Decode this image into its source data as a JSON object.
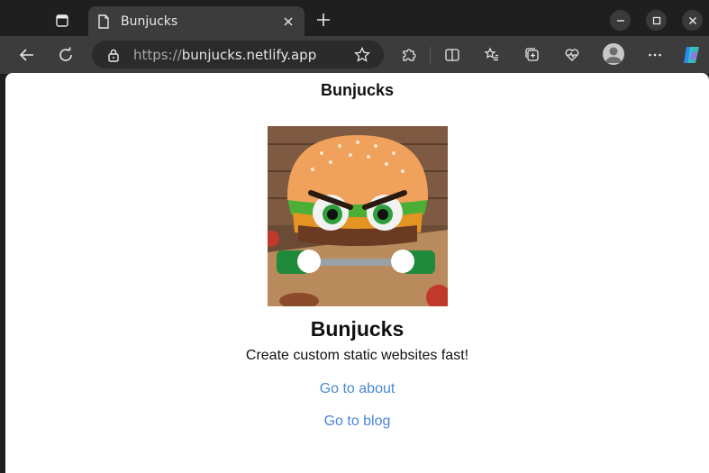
{
  "browser": {
    "tab": {
      "title": "Bunjucks"
    },
    "address": {
      "scheme": "https://",
      "host": "bunjucks.netlify.app"
    },
    "icons": [
      "tab-actions-icon",
      "page-icon",
      "close-icon",
      "plus-icon",
      "minimize-icon",
      "maximize-icon",
      "close-window-icon",
      "back-icon",
      "refresh-icon",
      "lock-icon",
      "star-icon",
      "extensions-icon",
      "split-screen-icon",
      "favorites-icon",
      "collections-icon",
      "browser-essentials-icon",
      "profile-avatar",
      "more-icon",
      "copilot-icon"
    ]
  },
  "page": {
    "header": "Bunjucks",
    "title": "Bunjucks",
    "tagline": "Create custom static websites fast!",
    "links": [
      {
        "label": "Go to about"
      },
      {
        "label": "Go to blog"
      }
    ],
    "hero_image": "burger-mascot-image"
  },
  "colors": {
    "chrome_dark": "#1f1f1f",
    "toolbar": "#3c3c3c",
    "page_bg": "#ffffff",
    "link": "#4a86d8"
  }
}
